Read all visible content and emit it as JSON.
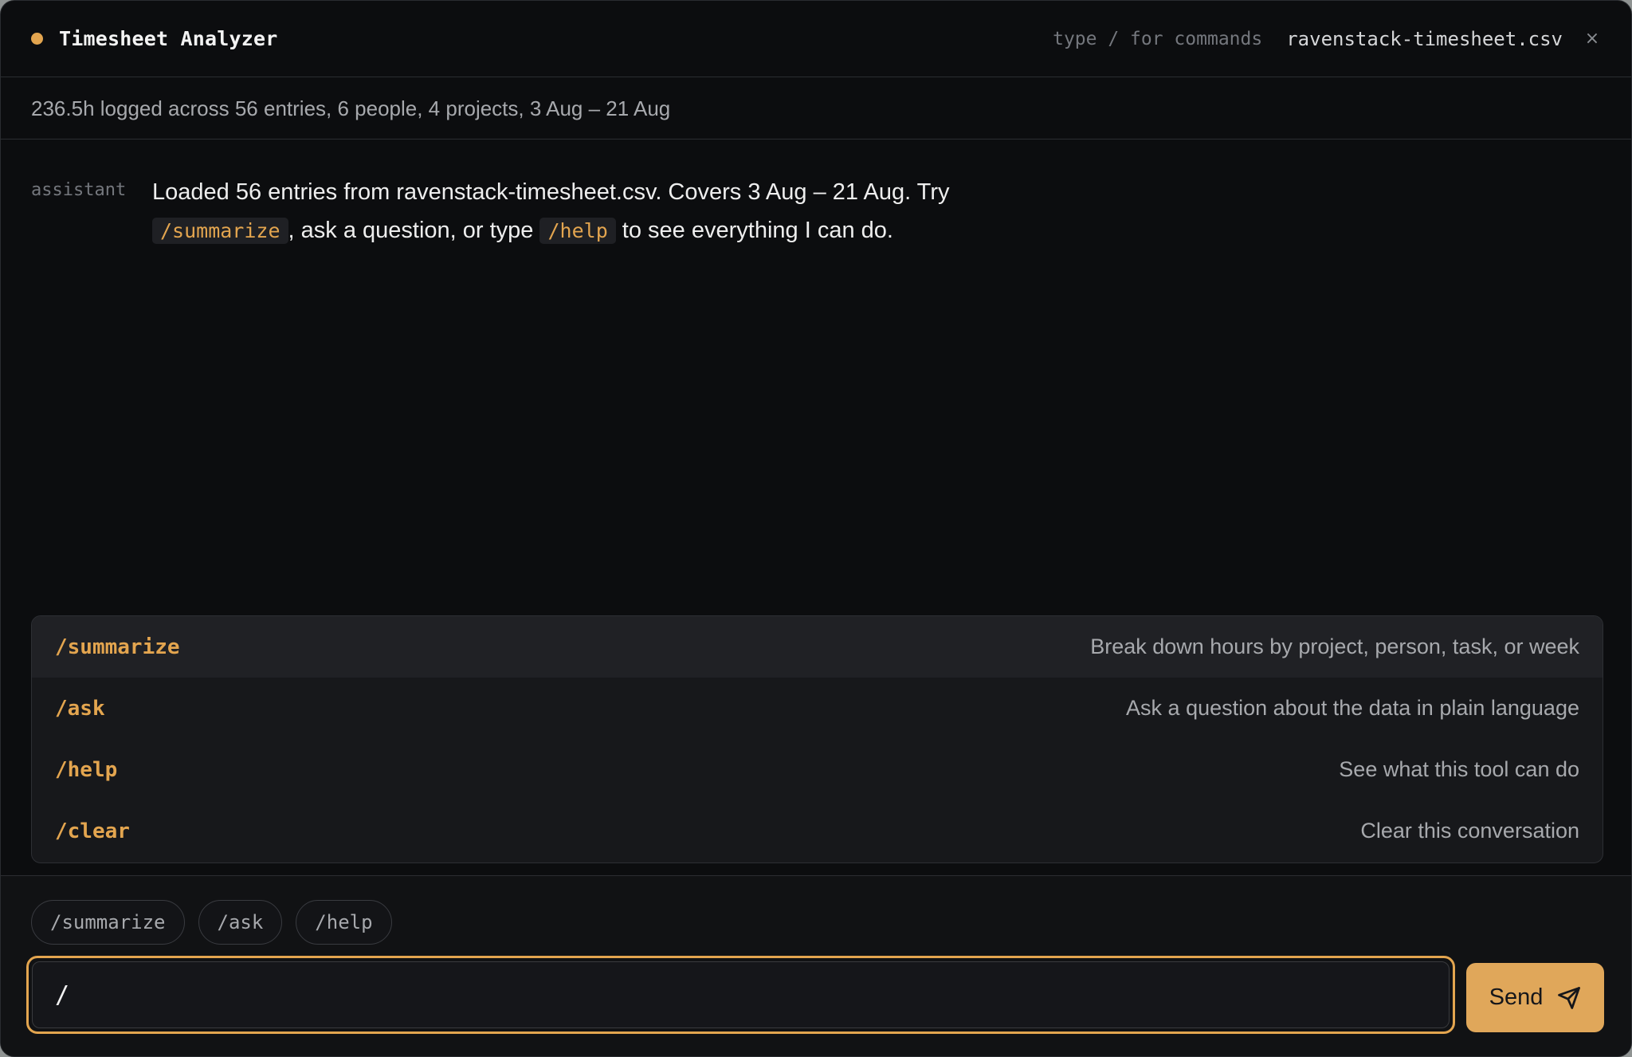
{
  "header": {
    "title": "Timesheet Analyzer",
    "hint": "type / for commands",
    "filename": "ravenstack-timesheet.csv",
    "close_glyph": "×",
    "status_color": "#e3a54f"
  },
  "summary": {
    "text": "236.5h logged across 56 entries, 6 people, 4 projects, 3 Aug – 21 Aug"
  },
  "chat": {
    "messages": [
      {
        "role": "assistant",
        "parts": {
          "p1": "Loaded 56 entries from ravenstack-timesheet.csv. Covers 3 Aug – 21 Aug. Try ",
          "code1": "/summarize",
          "p2": ", ask a question, or type ",
          "code2": "/help",
          "p3": " to see everything I can do."
        }
      }
    ]
  },
  "command_menu": {
    "items": [
      {
        "command": "/summarize",
        "description": "Break down hours by project, person, task, or week",
        "active": true
      },
      {
        "command": "/ask",
        "description": "Ask a question about the data in plain language",
        "active": false
      },
      {
        "command": "/help",
        "description": "See what this tool can do",
        "active": false
      },
      {
        "command": "/clear",
        "description": "Clear this conversation",
        "active": false
      }
    ]
  },
  "composer": {
    "chips": [
      "/summarize",
      "/ask",
      "/help"
    ],
    "input_value": "/",
    "send_label": "Send",
    "send_icon": "send-icon",
    "accent_color": "#e3a54f"
  }
}
